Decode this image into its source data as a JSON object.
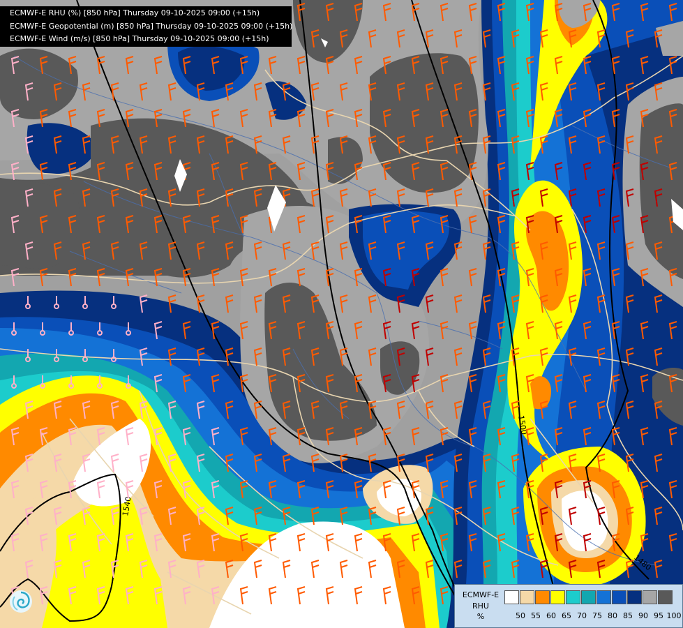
{
  "title_lines": [
    "ECMWF-E RHU (%) [850 hPa] Thursday 09-10-2025 09:00 (+15h)",
    "ECMWF-E Geopotential (m) [850 hPa] Thursday 09-10-2025 09:00 (+15h)",
    "ECMWF-E Wind (m/s) [850 hPa] Thursday 09-10-2025 09:00 (+15h)"
  ],
  "legend": {
    "model": "ECMWF-E",
    "variable": "RHU",
    "unit": "%",
    "ticks": [
      "50",
      "55",
      "60",
      "65",
      "70",
      "75",
      "80",
      "85",
      "90",
      "95",
      "100"
    ],
    "colors": [
      "#ffffff",
      "#f5d9a8",
      "#ff8a00",
      "#ffff00",
      "#1ccccc",
      "#13a7b0",
      "#1472d6",
      "#0a4fb8",
      "#06307f",
      "#a6a6a6",
      "#595959"
    ]
  },
  "contour_labels": [
    "1540",
    "1500",
    "1480"
  ],
  "map_colors": {
    "border": "#e8d5b0",
    "river": "#4a6fb0",
    "contour": "#000000",
    "barb_orange": "#ff5a00",
    "barb_pink": "#ffb0c8",
    "barb_red": "#c00000"
  },
  "logo_icon": "ecmwf-swirl-logo"
}
